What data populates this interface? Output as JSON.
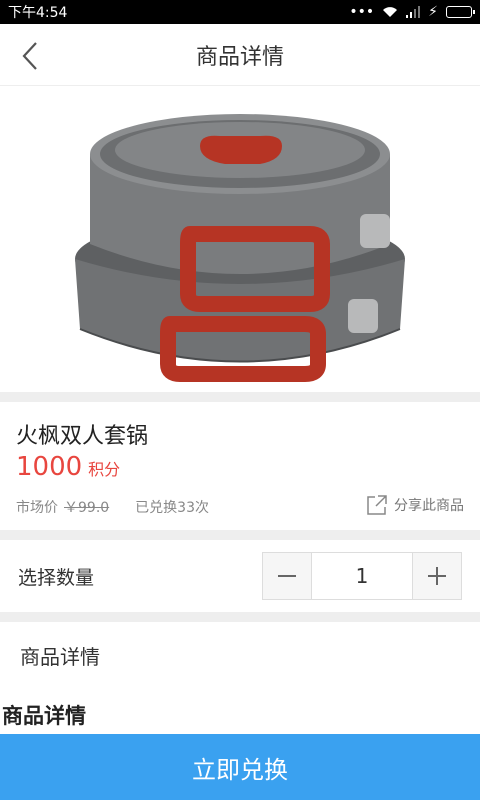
{
  "status_bar": {
    "time": "下午4:54"
  },
  "nav": {
    "title": "商品详情"
  },
  "product": {
    "name": "火枫双人套锅",
    "points": "1000",
    "points_unit": "积分",
    "market_price_label": "市场价",
    "market_price": "￥99.0",
    "exchanged": "已兑换33次",
    "share_label": "分享此商品"
  },
  "quantity": {
    "label": "选择数量",
    "value": "1"
  },
  "details": {
    "tab_label": "商品详情",
    "heading": "商品详情"
  },
  "action": {
    "redeem_label": "立即兑换"
  },
  "colors": {
    "accent": "#3aa1f0",
    "price": "#e8463f",
    "separator": "#eeeeee"
  }
}
